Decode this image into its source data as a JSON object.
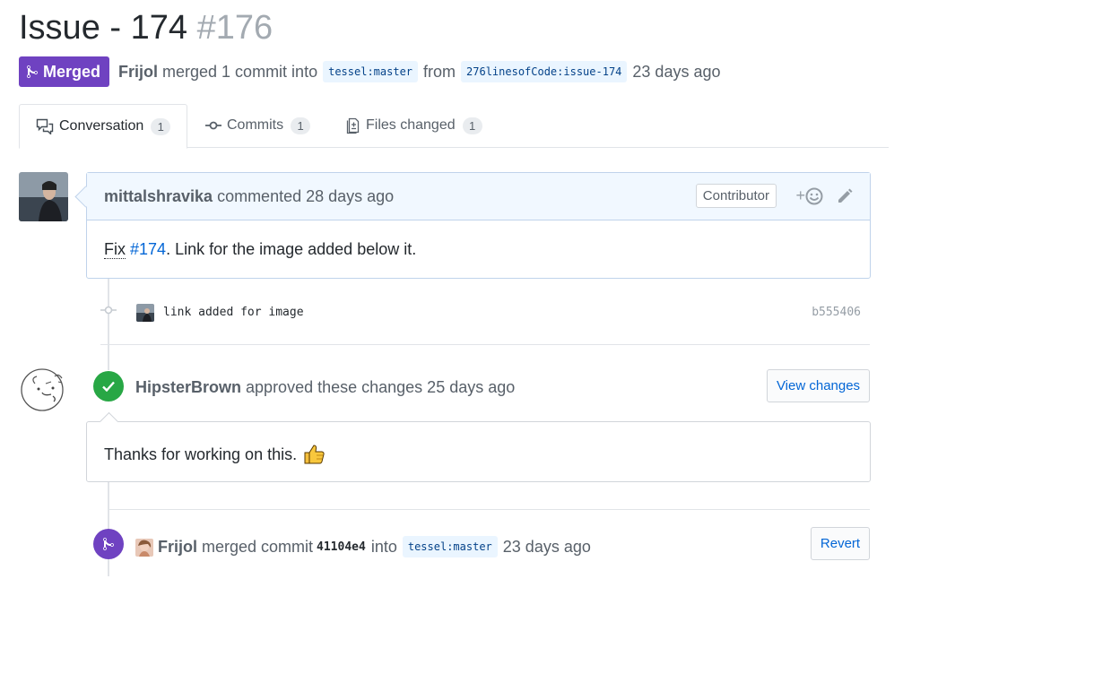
{
  "header": {
    "title": "Issue - 174",
    "number": "#176",
    "state": "Merged",
    "author": "Frijol",
    "summary_text": "merged 1 commit into",
    "base_branch": "tessel:master",
    "from_text": "from",
    "head_branch": "276linesofCode:issue-174",
    "time": "23 days ago"
  },
  "tabs": [
    {
      "label": "Conversation",
      "count": "1"
    },
    {
      "label": "Commits",
      "count": "1"
    },
    {
      "label": "Files changed",
      "count": "1"
    }
  ],
  "comment": {
    "author": "mittalshravika",
    "action": "commented 28 days ago",
    "role": "Contributor",
    "body_prefix": "Fix",
    "body_link": "#174",
    "body_suffix": ". Link for the image added below it."
  },
  "commit": {
    "message": "link added for image",
    "sha": "b555406"
  },
  "review": {
    "author": "HipsterBrown",
    "action": "approved these changes 25 days ago",
    "button": "View changes",
    "body": "Thanks for working on this."
  },
  "merge_event": {
    "author": "Frijol",
    "text": "merged commit",
    "sha": "41104e4",
    "into_text": "into",
    "branch": "tessel:master",
    "time": "23 days ago",
    "button": "Revert"
  },
  "colors": {
    "merged": "#6f42c1",
    "approved": "#28a745",
    "link": "#0366d6"
  }
}
